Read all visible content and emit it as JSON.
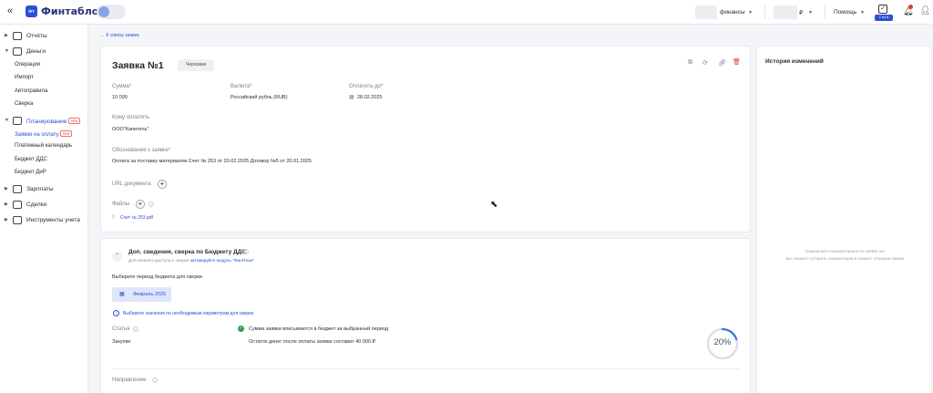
{
  "header": {
    "logo_mark": "ФТ",
    "logo_text": "Финтабло",
    "company": "финансы",
    "currency": "₽",
    "help": "Помощь",
    "tasks_badge": "7 из 8"
  },
  "sidebar": {
    "sections": [
      {
        "label": "Отчёты",
        "icon": "chart-icon"
      },
      {
        "label": "Деньги",
        "icon": "wallet-icon"
      },
      {
        "label": "Планирование",
        "icon": "plan-icon",
        "badge": "new"
      },
      {
        "label": "Зарплаты",
        "icon": "person-icon"
      },
      {
        "label": "Сделки",
        "icon": "briefcase-icon"
      },
      {
        "label": "Инструменты учета",
        "icon": "table-icon"
      }
    ],
    "money_items": [
      "Операции",
      "Импорт",
      "Автоправила",
      "Сверка"
    ],
    "plan_items": [
      {
        "label": "Заявки на оплату",
        "badge": "new"
      },
      {
        "label": "Платежный календарь"
      },
      {
        "label": "Бюджет ДДС"
      },
      {
        "label": "Бюджет ДиР"
      }
    ]
  },
  "breadcrumb": "← К списку заявок",
  "request": {
    "title": "Заявка №1",
    "status": "Черновик",
    "amount_label": "Сумма*",
    "amount_value": "10 000",
    "currency_label": "Валюта*",
    "currency_value": "Российский рубль (RUB)",
    "pay_by_label": "Оплатить до*",
    "pay_by_value": "28.02.2025",
    "payee_label": "Кому оплатить",
    "payee_value": "ООО\"Капитель\"",
    "reason_label": "Обоснование к заявке*",
    "reason_value": "Оплата за поставку материалов Счет № 253 от 20.02.2025 Договор №5 от 20.01.2025",
    "url_label": "URL документа",
    "files_label": "Файлы",
    "file_name": "Счет № 253.pdf"
  },
  "budget": {
    "title": "Доп. сведения, сверка по Бюджету ДДС",
    "subtitle_prefix": "Для полного доступа к сверке",
    "subtitle_link": "активируйте модуль \"ФинПлан\"",
    "period_label": "Выберите период бюджета для сверки",
    "period_button": "Февраль 2025",
    "hint": "Выберите значения по необходимым параметрам для сверки",
    "article_label": "Статья",
    "article_value": "Закупки",
    "fit_text": "Сумма заявки вписывается в бюджет за выбранный период",
    "remain_text": "Остаток денег после оплаты заявки составит 40 000 ₽",
    "progress_text": "20%",
    "progress_value": 0.2,
    "direction_label": "Направление"
  },
  "history": {
    "title": "История изменений",
    "empty_line1": "Изменений и комментариев по заявке нет",
    "empty_line2": "Вы сможете оставить комментарий в момент отправки заявки"
  }
}
